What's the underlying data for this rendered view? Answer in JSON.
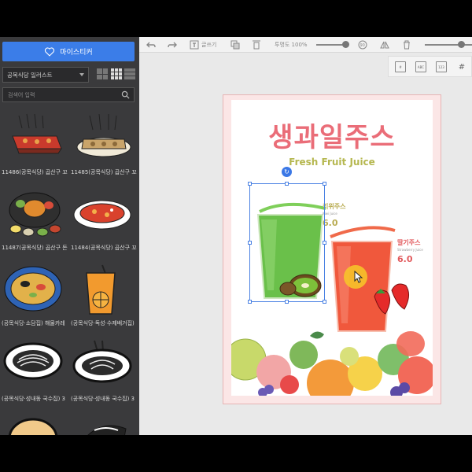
{
  "sidebar": {
    "my_sticker_label": "마이스티커",
    "category_select": "공목식당 일러스트",
    "search_placeholder": "검색어 입력",
    "items": [
      {
        "caption": "11486(공목식당) 곱산구 꼬"
      },
      {
        "caption": "11485(공목식당) 곱산구 꼬"
      },
      {
        "caption": "11487(공목식당) 곱산구 돈"
      },
      {
        "caption": "11484(공목식당) 곱산구 꼬"
      },
      {
        "caption": "(공목식당·소담집) 해물카레"
      },
      {
        "caption": "(공목식당·독성·수제배거집)"
      },
      {
        "caption": "(공목식당·성내동 국수집) 3"
      },
      {
        "caption": "(공목식당·성내동 국수집) 3"
      }
    ]
  },
  "toolbar": {
    "text_tool_label": "글쓰기",
    "opacity_label": "투명도 100%",
    "opacity_value": 1.0
  },
  "canvas": {
    "title_kr": "생과일주스",
    "title_en": "Fresh Fruit Juice",
    "drinks": [
      {
        "name": "키위주스",
        "sub": "Kiwi Juice",
        "price": "6.0"
      },
      {
        "name": "딸기주스",
        "sub": "Strawberry Juice",
        "price": "6.0"
      }
    ]
  },
  "colors": {
    "accent": "#3b7de8",
    "title_pink": "#ea6d78",
    "title_olive": "#b5b74f",
    "sidebar_bg": "#3a3a3c"
  }
}
